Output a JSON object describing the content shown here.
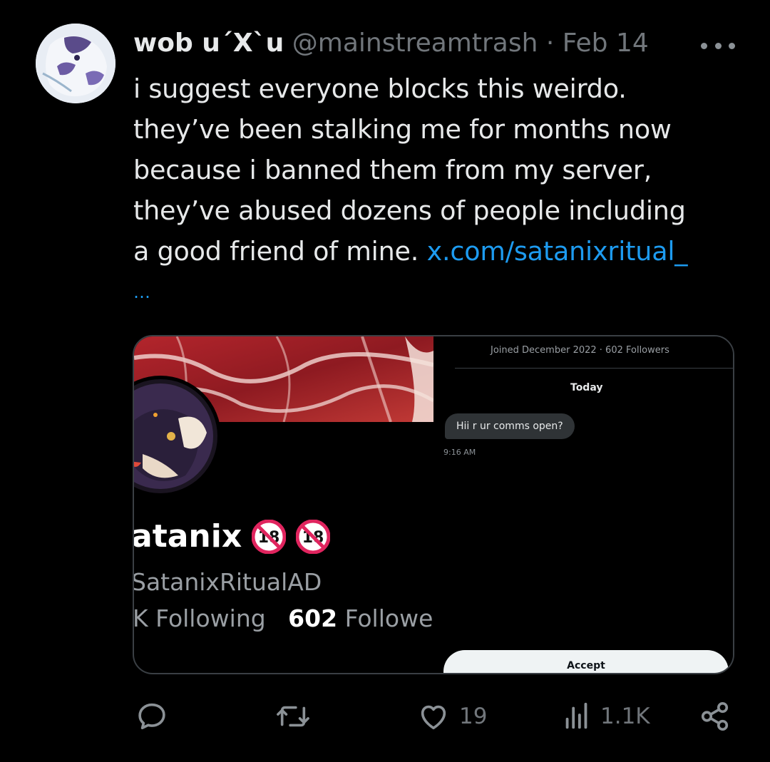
{
  "author": {
    "display_name": "wob u´X`u",
    "handle": "@mainstreamtrash",
    "separator": "·",
    "date": "Feb 14"
  },
  "tweet": {
    "lines": [
      "i suggest everyone blocks this weirdo.",
      "they’ve been stalking me for months now",
      "because i banned them from my server,",
      "they’ve abused dozens of people including"
    ],
    "last_line_text": "a good friend of mine.",
    "link_text": "x.com/satanixritual_",
    "truncation": "…"
  },
  "media": {
    "profile": {
      "name": "atanix",
      "handle": "SatanixRitualAD",
      "following_label": "Following",
      "following_prefix": "K",
      "followers_count": "602",
      "followers_label": "Followers",
      "badge_icons": [
        "no-under-18-icon",
        "no-under-18-icon"
      ]
    },
    "dm": {
      "joined_info": "Joined December 2022 · 602 Followers",
      "day_label": "Today",
      "message": "Hii r ur comms open?",
      "time": "9:16 AM",
      "accept_label": "Accept"
    }
  },
  "actions": {
    "reply_icon": "reply-icon",
    "retweet_icon": "retweet-icon",
    "like_icon": "heart-icon",
    "like_count": "19",
    "views_icon": "views-icon",
    "views_count": "1.1K",
    "share_icon": "share-icon"
  },
  "colors": {
    "background": "#000000",
    "text": "#e7e9ea",
    "muted": "#71767b",
    "link": "#1d9bf0"
  }
}
